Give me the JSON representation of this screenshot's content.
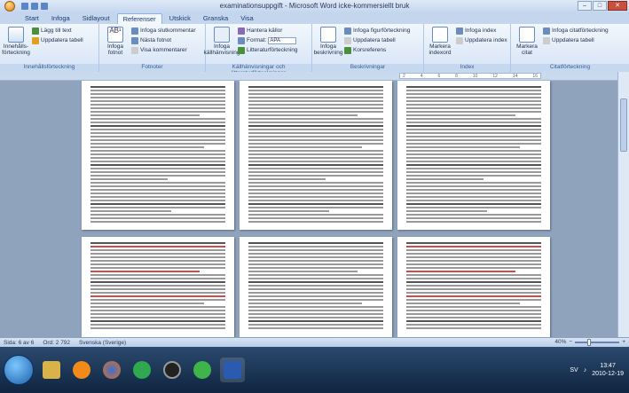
{
  "window": {
    "title": "examinationsuppgift - Microsoft Word icke-kommersiellt bruk"
  },
  "tabs": [
    "Start",
    "Infoga",
    "Sidlayout",
    "Referenser",
    "Utskick",
    "Granska",
    "Visa"
  ],
  "active_tab": "Referenser",
  "ribbon": {
    "innehall": {
      "big": "Innehålls-förteckning",
      "items": [
        "Lägg till text",
        "Uppdatera tabell"
      ],
      "label": "Innehållsförteckning"
    },
    "fotnoter": {
      "big": "Infoga fotnot",
      "items": [
        "Infoga slutkommentar",
        "Nästa fotnot",
        "Visa kommentarer"
      ],
      "label": "Fotnoter"
    },
    "kallor": {
      "big": "Infoga källhänvisning",
      "items": [
        "Hantera källor",
        "Format:",
        "Litteraturförteckning"
      ],
      "format_value": "APA",
      "label": "Källhänvisningar och litteraturförteckningar"
    },
    "beskrivningar": {
      "big": "Infoga beskrivning",
      "items": [
        "Infoga figurförteckning",
        "Uppdatera tabell",
        "Korsreferens"
      ],
      "label": "Beskrivningar"
    },
    "index": {
      "big": "Markera indexord",
      "items": [
        "Infoga index",
        "Uppdatera index"
      ],
      "label": "Index"
    },
    "citat": {
      "big": "Markera citat",
      "items": [
        "Infoga citatförteckning",
        "Uppdatera tabell"
      ],
      "label": "Citatförteckning"
    }
  },
  "ruler_marks": [
    "2",
    "4",
    "6",
    "8",
    "10",
    "12",
    "14",
    "16"
  ],
  "status": {
    "page": "Sida: 6 av 6",
    "words": "Ord: 2 792",
    "language": "Svenska (Sverige)",
    "zoom": "40%"
  },
  "taskbar": {
    "lang": "SV",
    "time": "13:47",
    "date": "2010-12-19"
  },
  "colors": {
    "ribbon": "#dbe7f6",
    "doc_bg": "#8fa3bd",
    "taskbar": "#1b3556",
    "accent_red": "#d24a4a"
  }
}
